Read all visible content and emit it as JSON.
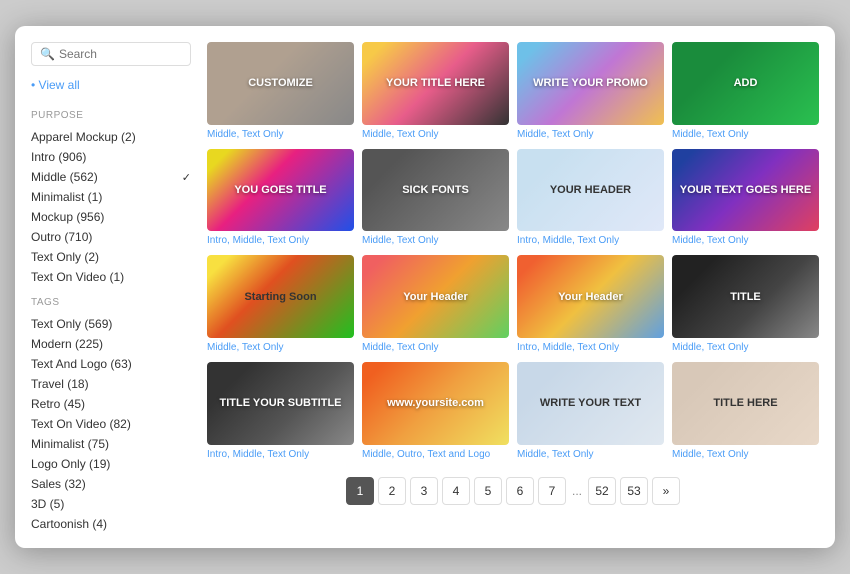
{
  "search": {
    "placeholder": "Search"
  },
  "sidebar": {
    "view_all": "View all",
    "purpose_label": "Purpose",
    "filters_purpose": [
      {
        "label": "Apparel Mockup (2)",
        "checked": false
      },
      {
        "label": "Intro (906)",
        "checked": false
      },
      {
        "label": "Middle (562)",
        "checked": true
      },
      {
        "label": "Minimalist (1)",
        "checked": false
      },
      {
        "label": "Mockup (956)",
        "checked": false
      },
      {
        "label": "Outro (710)",
        "checked": false
      },
      {
        "label": "Text Only (2)",
        "checked": false
      },
      {
        "label": "Text On Video (1)",
        "checked": false
      }
    ],
    "tags_label": "Tags",
    "filters_tags": [
      {
        "label": "Text Only (569)"
      },
      {
        "label": "Modern (225)"
      },
      {
        "label": "Text And Logo (63)"
      },
      {
        "label": "Travel (18)"
      },
      {
        "label": "Retro (45)"
      },
      {
        "label": "Text On Video (82)"
      },
      {
        "label": "Minimalist (75)"
      },
      {
        "label": "Logo Only (19)"
      },
      {
        "label": "Sales (32)"
      },
      {
        "label": "3D (5)"
      },
      {
        "label": "Cartoonish (4)"
      }
    ]
  },
  "grid": {
    "cards": [
      {
        "id": 1,
        "thumb_class": "thumb-1",
        "overlay": "CUSTOMIZE",
        "label": "Middle, Text Only"
      },
      {
        "id": 2,
        "thumb_class": "thumb-2",
        "overlay": "YOUR TITLE HERE",
        "label": "Middle, Text Only"
      },
      {
        "id": 3,
        "thumb_class": "thumb-3",
        "overlay": "WRITE YOUR PROMO",
        "label": "Middle, Text Only"
      },
      {
        "id": 4,
        "thumb_class": "thumb-4",
        "overlay": "ADD",
        "label": "Middle, Text Only"
      },
      {
        "id": 5,
        "thumb_class": "thumb-5",
        "overlay": "YOU GOES TITLE",
        "label": "Intro, Middle, Text Only"
      },
      {
        "id": 6,
        "thumb_class": "thumb-6",
        "overlay": "SICK FONTS",
        "label": "Middle, Text Only"
      },
      {
        "id": 7,
        "thumb_class": "thumb-7",
        "overlay": "YOUR HEADER",
        "label": "Intro, Middle, Text Only"
      },
      {
        "id": 8,
        "thumb_class": "thumb-8",
        "overlay": "YOUR TEXT GOES HERE",
        "label": "Middle, Text Only"
      },
      {
        "id": 9,
        "thumb_class": "thumb-9",
        "overlay": "Starting Soon",
        "label": "Middle, Text Only"
      },
      {
        "id": 10,
        "thumb_class": "thumb-10",
        "overlay": "Your Header",
        "label": "Middle, Text Only"
      },
      {
        "id": 11,
        "thumb_class": "thumb-11",
        "overlay": "Your Header",
        "label": "Intro, Middle, Text Only"
      },
      {
        "id": 12,
        "thumb_class": "thumb-12",
        "overlay": "TITLE",
        "label": "Middle, Text Only"
      },
      {
        "id": 13,
        "thumb_class": "thumb-13",
        "overlay": "TITLE YOUR SUBTITLE",
        "label": "Intro, Middle, Text Only"
      },
      {
        "id": 14,
        "thumb_class": "thumb-14",
        "overlay": "www.yoursite.com",
        "label": "Middle, Outro, Text and Logo"
      },
      {
        "id": 15,
        "thumb_class": "thumb-15",
        "overlay": "WRITE YOUR TEXT",
        "label": "Middle, Text Only"
      },
      {
        "id": 16,
        "thumb_class": "thumb-16",
        "overlay": "TITLE HERE",
        "label": "Middle, Text Only"
      }
    ]
  },
  "pagination": {
    "pages": [
      "1",
      "2",
      "3",
      "4",
      "5",
      "6",
      "7",
      "...",
      "52",
      "53",
      "»"
    ],
    "active": "1"
  }
}
